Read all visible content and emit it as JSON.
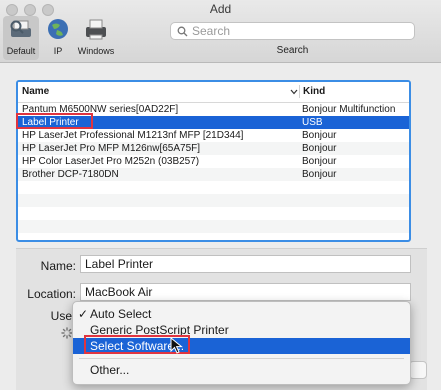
{
  "window": {
    "title": "Add"
  },
  "toolbar": {
    "buttons": [
      {
        "label": "Default",
        "icon": "default-printer-icon"
      },
      {
        "label": "IP",
        "icon": "globe-icon"
      },
      {
        "label": "Windows",
        "icon": "windows-printer-icon"
      }
    ],
    "search_placeholder": "Search",
    "search_label": "Search"
  },
  "table": {
    "columns": [
      "Name",
      "Kind"
    ],
    "rows": [
      {
        "name": "Pantum M6500NW series[0AD22F]",
        "kind": "Bonjour Multifunction"
      },
      {
        "name": "Label Printer",
        "kind": "USB"
      },
      {
        "name": "HP LaserJet Professional M1213nf MFP [21D344]",
        "kind": "Bonjour"
      },
      {
        "name": "HP LaserJet Pro MFP M126nw[65A75F]",
        "kind": "Bonjour"
      },
      {
        "name": "HP Color LaserJet Pro M252n (03B257)",
        "kind": "Bonjour"
      },
      {
        "name": "Brother DCP-7180DN",
        "kind": "Bonjour"
      }
    ]
  },
  "form": {
    "name_label": "Name:",
    "name_value": "Label Printer",
    "location_label": "Location:",
    "location_value": "MacBook Air",
    "use_label": "Use"
  },
  "menu": {
    "check": "✓",
    "items": [
      "Auto Select",
      "Generic PostScript Printer",
      "Select Software...",
      "Other..."
    ]
  },
  "colors": {
    "selection": "#1a63d6",
    "highlight_box": "#e0343f",
    "focus_ring": "#3b8de5"
  }
}
